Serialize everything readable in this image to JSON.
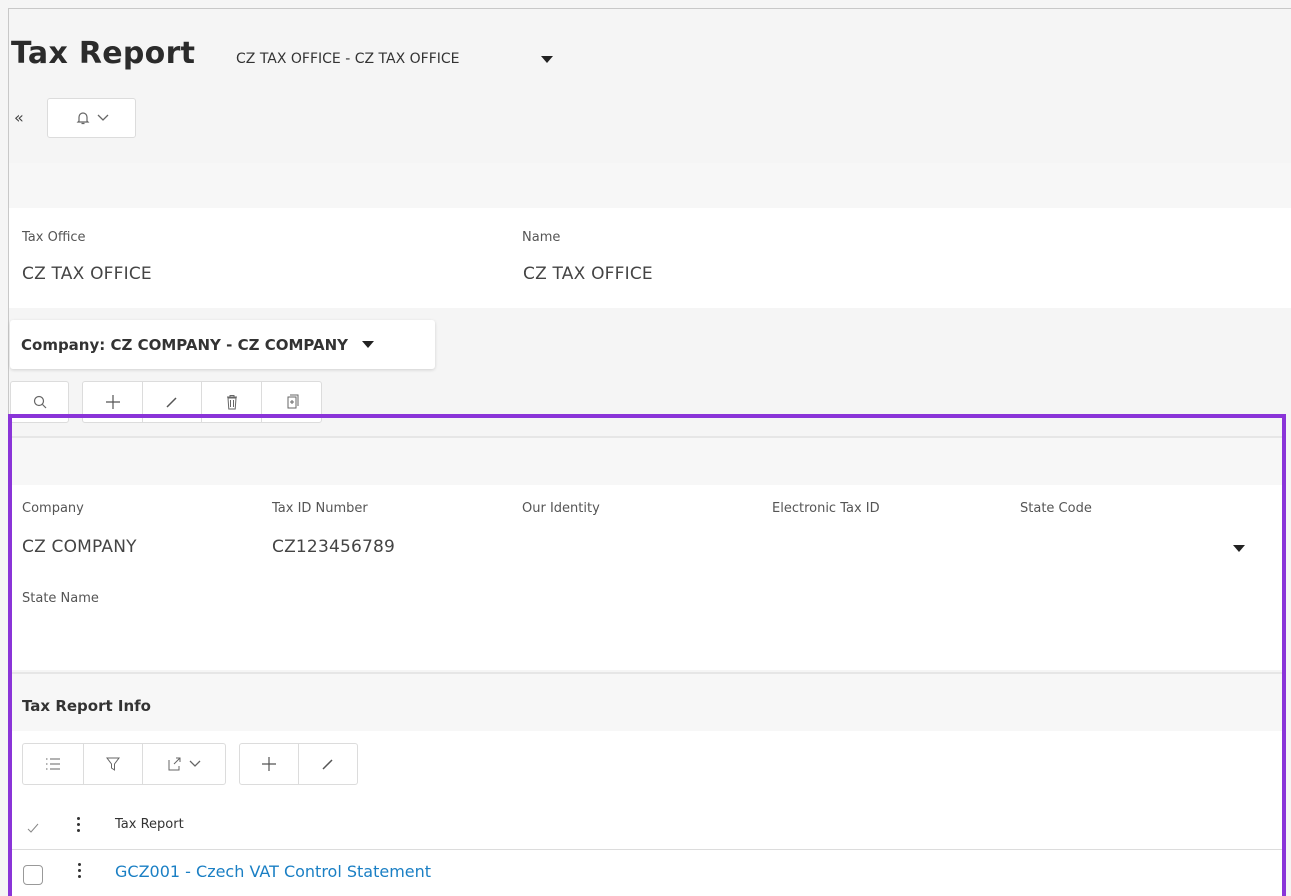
{
  "header": {
    "title": "Tax Report",
    "subtitle": "CZ TAX OFFICE - CZ TAX OFFICE",
    "collapse_glyph": "«",
    "action_icon": "bell-settings-icon"
  },
  "tax_office_section": {
    "tax_office_label": "Tax Office",
    "tax_office_value": "CZ TAX OFFICE",
    "name_label": "Name",
    "name_value": "CZ TAX OFFICE"
  },
  "company_selector": {
    "label": "Company: CZ COMPANY - CZ COMPANY"
  },
  "company_toolbar": {
    "icons": [
      "search-icon",
      "add-icon",
      "edit-icon",
      "delete-icon",
      "duplicate-icon"
    ]
  },
  "company_detail": {
    "company_label": "Company",
    "company_value": "CZ COMPANY",
    "tax_id_label": "Tax ID Number",
    "tax_id_value": "CZ123456789",
    "our_identity_label": "Our Identity",
    "electronic_tax_id_label": "Electronic Tax ID",
    "state_code_label": "State Code",
    "state_name_label": "State Name"
  },
  "tax_report_info": {
    "title": "Tax Report Info",
    "toolbar_icons": [
      "list-icon",
      "filter-icon",
      "export-icon",
      "add-icon",
      "edit-icon"
    ],
    "column_header": "Tax Report",
    "rows": [
      {
        "tax_report": "GCZ001 - Czech VAT Control Statement"
      }
    ]
  },
  "colors": {
    "accent_highlight": "#8a34d8",
    "link": "#1a7fc4"
  }
}
